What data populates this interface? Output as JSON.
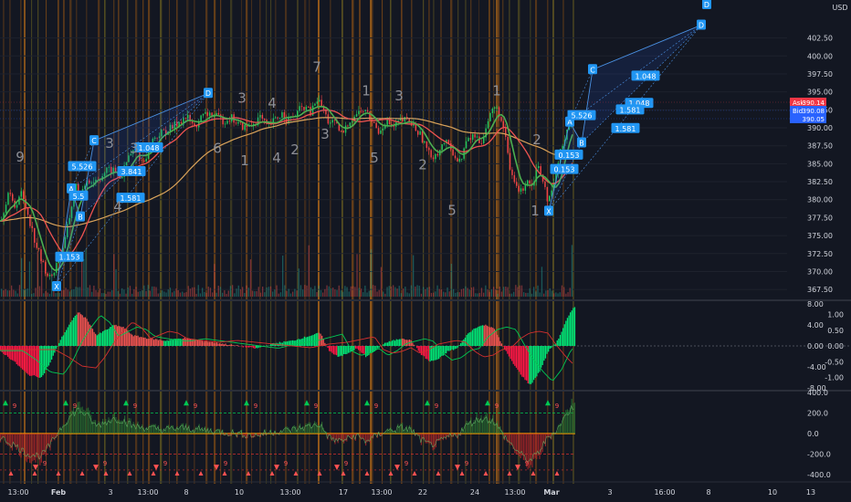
{
  "currency": "USD",
  "chart_data": [
    {
      "type": "candlestick",
      "panel": "price",
      "y_ticks": [
        "402.50",
        "400.00",
        "397.50",
        "395.00",
        "392.50",
        "390.00",
        "387.50",
        "385.00",
        "382.50",
        "380.00",
        "377.50",
        "375.00",
        "372.50",
        "370.00",
        "367.50"
      ],
      "ylim": [
        366.5,
        405.5
      ],
      "x_ticks": [
        "13:00",
        "Feb",
        "3",
        "13:00",
        "8",
        "10",
        "13:00",
        "17",
        "13:00",
        "22",
        "24",
        "13:00",
        "Mar",
        "3",
        "16:00",
        "8",
        "10",
        "13"
      ],
      "price_badges": [
        {
          "label": "Ask",
          "value": "390.14",
          "color": "#f23645"
        },
        {
          "label": "Bid",
          "value": "390.08",
          "color": "#2962ff"
        },
        {
          "label": "",
          "value": "390.05",
          "color": "#2962ff"
        }
      ],
      "close_path": [
        [
          0,
          377
        ],
        [
          8,
          381
        ],
        [
          15,
          379
        ],
        [
          22,
          381
        ],
        [
          30,
          378
        ],
        [
          38,
          374
        ],
        [
          46,
          371
        ],
        [
          54,
          369
        ],
        [
          58,
          370
        ],
        [
          64,
          372
        ],
        [
          70,
          374
        ],
        [
          76,
          378
        ],
        [
          82,
          382
        ],
        [
          88,
          380
        ],
        [
          94,
          383
        ],
        [
          100,
          382.5
        ],
        [
          108,
          383
        ],
        [
          116,
          384
        ],
        [
          124,
          384
        ],
        [
          132,
          383
        ],
        [
          140,
          386
        ],
        [
          148,
          387
        ],
        [
          156,
          385
        ],
        [
          164,
          388
        ],
        [
          172,
          389
        ],
        [
          180,
          389.5
        ],
        [
          188,
          390
        ],
        [
          196,
          391
        ],
        [
          204,
          391.5
        ],
        [
          212,
          390
        ],
        [
          220,
          391.5
        ],
        [
          228,
          392
        ],
        [
          236,
          391.5
        ],
        [
          244,
          391
        ],
        [
          252,
          391.5
        ],
        [
          260,
          390.5
        ],
        [
          268,
          390
        ],
        [
          276,
          390.5
        ],
        [
          284,
          391.5
        ],
        [
          292,
          390
        ],
        [
          300,
          391
        ],
        [
          308,
          392
        ],
        [
          316,
          391
        ],
        [
          324,
          392
        ],
        [
          332,
          393
        ],
        [
          340,
          392
        ],
        [
          346,
          394
        ],
        [
          352,
          393
        ],
        [
          358,
          391
        ],
        [
          366,
          390.5
        ],
        [
          374,
          389
        ],
        [
          382,
          391
        ],
        [
          390,
          392
        ],
        [
          398,
          392.5
        ],
        [
          406,
          391
        ],
        [
          414,
          389.5
        ],
        [
          422,
          391
        ],
        [
          430,
          390
        ],
        [
          438,
          391
        ],
        [
          446,
          391
        ],
        [
          454,
          390
        ],
        [
          462,
          388.5
        ],
        [
          470,
          386
        ],
        [
          478,
          386.5
        ],
        [
          486,
          388
        ],
        [
          494,
          387
        ],
        [
          502,
          385
        ],
        [
          510,
          388
        ],
        [
          518,
          389
        ],
        [
          526,
          388
        ],
        [
          534,
          391
        ],
        [
          540,
          393
        ],
        [
          546,
          392
        ],
        [
          552,
          389
        ],
        [
          558,
          384
        ],
        [
          564,
          382
        ],
        [
          570,
          381
        ],
        [
          576,
          383
        ],
        [
          582,
          382
        ],
        [
          588,
          385
        ],
        [
          594,
          383
        ],
        [
          600,
          379.5
        ],
        [
          606,
          382
        ],
        [
          612,
          386
        ],
        [
          618,
          389
        ],
        [
          624,
          391
        ],
        [
          628,
          391
        ]
      ],
      "elliott_waves": [
        {
          "label": "9",
          "x": 22,
          "value": 385.3
        },
        {
          "label": "3",
          "x": 120,
          "value": 387.2
        },
        {
          "label": "3",
          "x": 147,
          "value": 386.5
        },
        {
          "label": "4",
          "x": 129,
          "value": 378.4
        },
        {
          "label": "6",
          "x": 238,
          "value": 386.5
        },
        {
          "label": "3",
          "x": 265,
          "value": 393.5
        },
        {
          "label": "4",
          "x": 298,
          "value": 392.8
        },
        {
          "label": "1",
          "x": 268,
          "value": 384.8
        },
        {
          "label": "4",
          "x": 303,
          "value": 385.2
        },
        {
          "label": "2",
          "x": 323,
          "value": 386.3
        },
        {
          "label": "7",
          "x": 347,
          "value": 397.8
        },
        {
          "label": "3",
          "x": 356,
          "value": 388.5
        },
        {
          "label": "1",
          "x": 401,
          "value": 394.5
        },
        {
          "label": "5",
          "x": 410,
          "value": 385.2
        },
        {
          "label": "3",
          "x": 437,
          "value": 393.8
        },
        {
          "label": "2",
          "x": 463,
          "value": 384.2
        },
        {
          "label": "5",
          "x": 495,
          "value": 377.9
        },
        {
          "label": "1",
          "x": 544,
          "value": 394.5
        },
        {
          "label": "2",
          "x": 588,
          "value": 387.7
        },
        {
          "label": "1",
          "x": 586,
          "value": 377.8
        }
      ],
      "harmonic_patterns": [
        {
          "points": [
            {
              "label": "X",
              "x": 62,
              "value": 367.9
            },
            {
              "label": "A",
              "x": 78,
              "value": 381.5
            },
            {
              "label": "B",
              "x": 88,
              "value": 377.6
            },
            {
              "label": "C",
              "x": 103,
              "value": 388.2
            },
            {
              "label": "D",
              "x": 228,
              "value": 394.8
            }
          ],
          "ratios": [
            {
              "label": "1.153",
              "x": 76,
              "value": 372.0
            },
            {
              "label": "5.5",
              "x": 86,
              "value": 380.5
            },
            {
              "label": "5.526",
              "x": 90,
              "value": 384.6
            },
            {
              "label": "1.048",
              "x": 163,
              "value": 387.2
            },
            {
              "label": "1.581",
              "x": 143,
              "value": 380.2
            },
            {
              "label": "3.841",
              "x": 144,
              "value": 383.9
            }
          ]
        },
        {
          "points": [
            {
              "label": "X",
              "x": 601,
              "value": 378.4
            },
            {
              "label": "A",
              "x": 624,
              "value": 390.8
            },
            {
              "label": "B",
              "x": 637,
              "value": 387.9
            },
            {
              "label": "C",
              "x": 649,
              "value": 398.1
            },
            {
              "label": "D",
              "x": 768,
              "value": 404.3
            }
          ],
          "ratios": [
            {
              "label": "0.153",
              "x": 618,
              "value": 384.2
            },
            {
              "label": "0.153",
              "x": 623,
              "value": 386.2
            },
            {
              "label": "5.526",
              "x": 637,
              "value": 391.7
            },
            {
              "label": "1.048",
              "x": 707,
              "value": 397.2
            },
            {
              "label": "1.048",
              "x": 700,
              "value": 393.4
            },
            {
              "label": "1.581",
              "x": 690,
              "value": 392.5
            },
            {
              "label": "1.581",
              "x": 685,
              "value": 389.9
            }
          ]
        }
      ],
      "top_label": "D",
      "moving_averages": [
        {
          "name": "",
          "color": "#26a69a"
        },
        {
          "name": "",
          "color": "#ef5350"
        },
        {
          "name": "",
          "color": "#d9a35b"
        }
      ]
    },
    {
      "type": "histogram",
      "panel": "oscillator",
      "y_ticks": [
        "8.00",
        "4.00",
        "0.00",
        "-4.00",
        "-8.00"
      ],
      "y_ticks_right": [
        "1.00",
        "0.50",
        "0.00",
        "-0.50",
        "-1.00"
      ],
      "ylim": [
        -8,
        8
      ],
      "wave": [
        [
          0,
          -1
        ],
        [
          15,
          -3
        ],
        [
          30,
          -5.5
        ],
        [
          45,
          -6
        ],
        [
          55,
          -3
        ],
        [
          65,
          1
        ],
        [
          75,
          4
        ],
        [
          85,
          6.5
        ],
        [
          95,
          5
        ],
        [
          105,
          2
        ],
        [
          115,
          3
        ],
        [
          125,
          4
        ],
        [
          135,
          3.5
        ],
        [
          145,
          2
        ],
        [
          160,
          1.5
        ],
        [
          180,
          1
        ],
        [
          200,
          1.5
        ],
        [
          220,
          1
        ],
        [
          240,
          0.5
        ],
        [
          260,
          0
        ],
        [
          280,
          -0.5
        ],
        [
          300,
          0.5
        ],
        [
          320,
          1
        ],
        [
          340,
          2
        ],
        [
          350,
          2.5
        ],
        [
          360,
          -1
        ],
        [
          370,
          -2
        ],
        [
          380,
          -1.5
        ],
        [
          390,
          -0.5
        ],
        [
          400,
          -2
        ],
        [
          410,
          -1
        ],
        [
          420,
          0.5
        ],
        [
          430,
          1
        ],
        [
          440,
          1.5
        ],
        [
          450,
          1
        ],
        [
          460,
          -1.5
        ],
        [
          470,
          -3
        ],
        [
          480,
          -2.5
        ],
        [
          490,
          -1
        ],
        [
          500,
          -0.5
        ],
        [
          510,
          2
        ],
        [
          520,
          3.5
        ],
        [
          530,
          4
        ],
        [
          540,
          3.5
        ],
        [
          550,
          0
        ],
        [
          560,
          -3
        ],
        [
          570,
          -5.5
        ],
        [
          580,
          -7.5
        ],
        [
          590,
          -5
        ],
        [
          600,
          -1
        ],
        [
          610,
          1
        ],
        [
          620,
          5
        ],
        [
          628,
          7.5
        ]
      ]
    },
    {
      "type": "line",
      "panel": "momentum",
      "y_ticks": [
        "400.0",
        "200.0",
        "0.0",
        "-200.0",
        "-400.0"
      ],
      "ylim": [
        -400,
        400
      ],
      "markers": [
        "9",
        "9",
        "9",
        "9",
        "9",
        "9",
        "9",
        "9",
        "9",
        "9",
        "9",
        "9",
        "9",
        "9",
        "9",
        "9",
        "9",
        "9",
        "9"
      ]
    }
  ]
}
